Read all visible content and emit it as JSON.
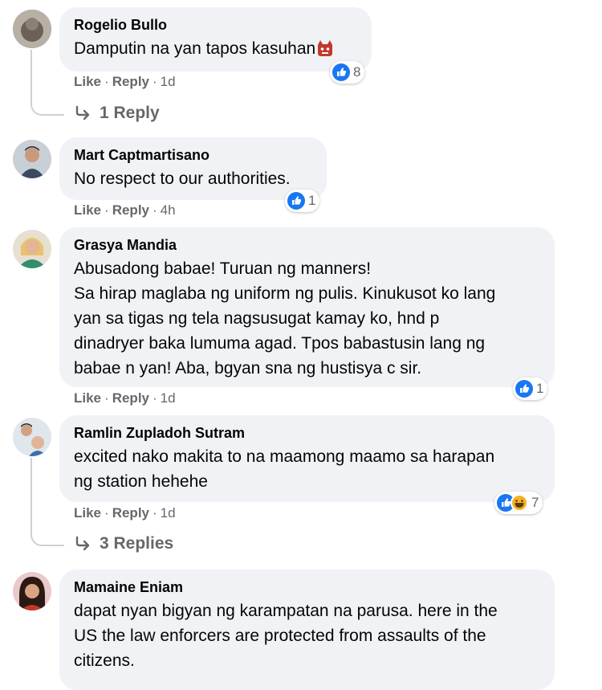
{
  "comments": [
    {
      "author": "Rogelio Bullo",
      "lines": [
        "Damputin na yan tapos kasuhan"
      ],
      "emoji": "angry-face-emoji",
      "like_label": "Like",
      "reply_label": "Reply",
      "time": "1d",
      "reactions": [
        "like-icon"
      ],
      "reaction_count": "8",
      "replies_label": "1 Reply"
    },
    {
      "author": "Mart Captmartisano",
      "lines": [
        "No respect to our authorities."
      ],
      "like_label": "Like",
      "reply_label": "Reply",
      "time": "4h",
      "reactions": [
        "like-icon"
      ],
      "reaction_count": "1"
    },
    {
      "author": "Grasya Mandia",
      "lines": [
        "Abusadong babae! Turuan ng manners!",
        "Sa hirap maglaba ng uniform ng pulis. Kinukusot ko lang",
        "yan sa tigas ng tela nagsusugat kamay ko, hnd p",
        "dinadryer baka lumuma agad. Tpos babastusin lang ng",
        "babae n yan! Aba, bgyan sna ng hustisya c sir."
      ],
      "like_label": "Like",
      "reply_label": "Reply",
      "time": "1d",
      "reactions": [
        "like-icon"
      ],
      "reaction_count": "1"
    },
    {
      "author": "Ramlin Zupladoh Sutram",
      "lines": [
        "excited nako makita to na maamong maamo sa harapan",
        "ng station hehehe"
      ],
      "like_label": "Like",
      "reply_label": "Reply",
      "time": "1d",
      "reactions": [
        "like-icon",
        "haha-icon"
      ],
      "reaction_count": "7",
      "replies_label": "3 Replies"
    },
    {
      "author": "Mamaine Eniam",
      "lines": [
        "dapat nyan bigyan ng karampatan na parusa. here in the",
        "US the law enforcers are protected from assaults of the",
        "citizens."
      ]
    }
  ],
  "dot": "·",
  "colors": {
    "bubble": "#f0f2f5",
    "like_blue": "#1877f2",
    "meta_gray": "#65676b"
  }
}
